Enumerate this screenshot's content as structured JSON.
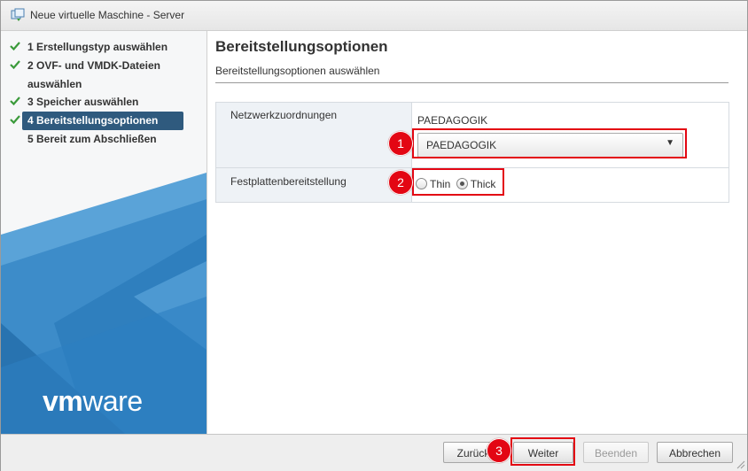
{
  "window": {
    "title": "Neue virtuelle Maschine - Server"
  },
  "wizard": {
    "steps": [
      {
        "label": "1 Erstellungstyp auswählen",
        "done": true
      },
      {
        "label": "2 OVF- und VMDK-Dateien auswählen",
        "done": true
      },
      {
        "label": "3 Speicher auswählen",
        "done": true
      },
      {
        "label": "4 Bereitstellungsoptionen",
        "done": true,
        "active": true
      },
      {
        "label": "5 Bereit zum Abschließen",
        "done": false
      }
    ],
    "brand": {
      "vm": "vm",
      "ware": "ware"
    }
  },
  "page": {
    "title": "Bereitstellungsoptionen",
    "subtitle": "Bereitstellungsoptionen auswählen"
  },
  "options": {
    "network": {
      "label": "Netzwerkzuordnungen",
      "source": "PAEDAGOGIK",
      "selected": "PAEDAGOGIK",
      "arrow": "▼"
    },
    "disk": {
      "label": "Festplattenbereitstellung",
      "thin": "Thin",
      "thick": "Thick",
      "selected": "Thick"
    }
  },
  "annotations": [
    "1",
    "2",
    "3"
  ],
  "buttons": {
    "back": "Zurück",
    "next": "Weiter",
    "finish": "Beenden",
    "cancel": "Abbrechen"
  },
  "colors": {
    "highlight": "#e30613",
    "active_step": "#2f5a7e",
    "check": "#3a9a3a",
    "panel_blue": "#2d7fc1"
  }
}
